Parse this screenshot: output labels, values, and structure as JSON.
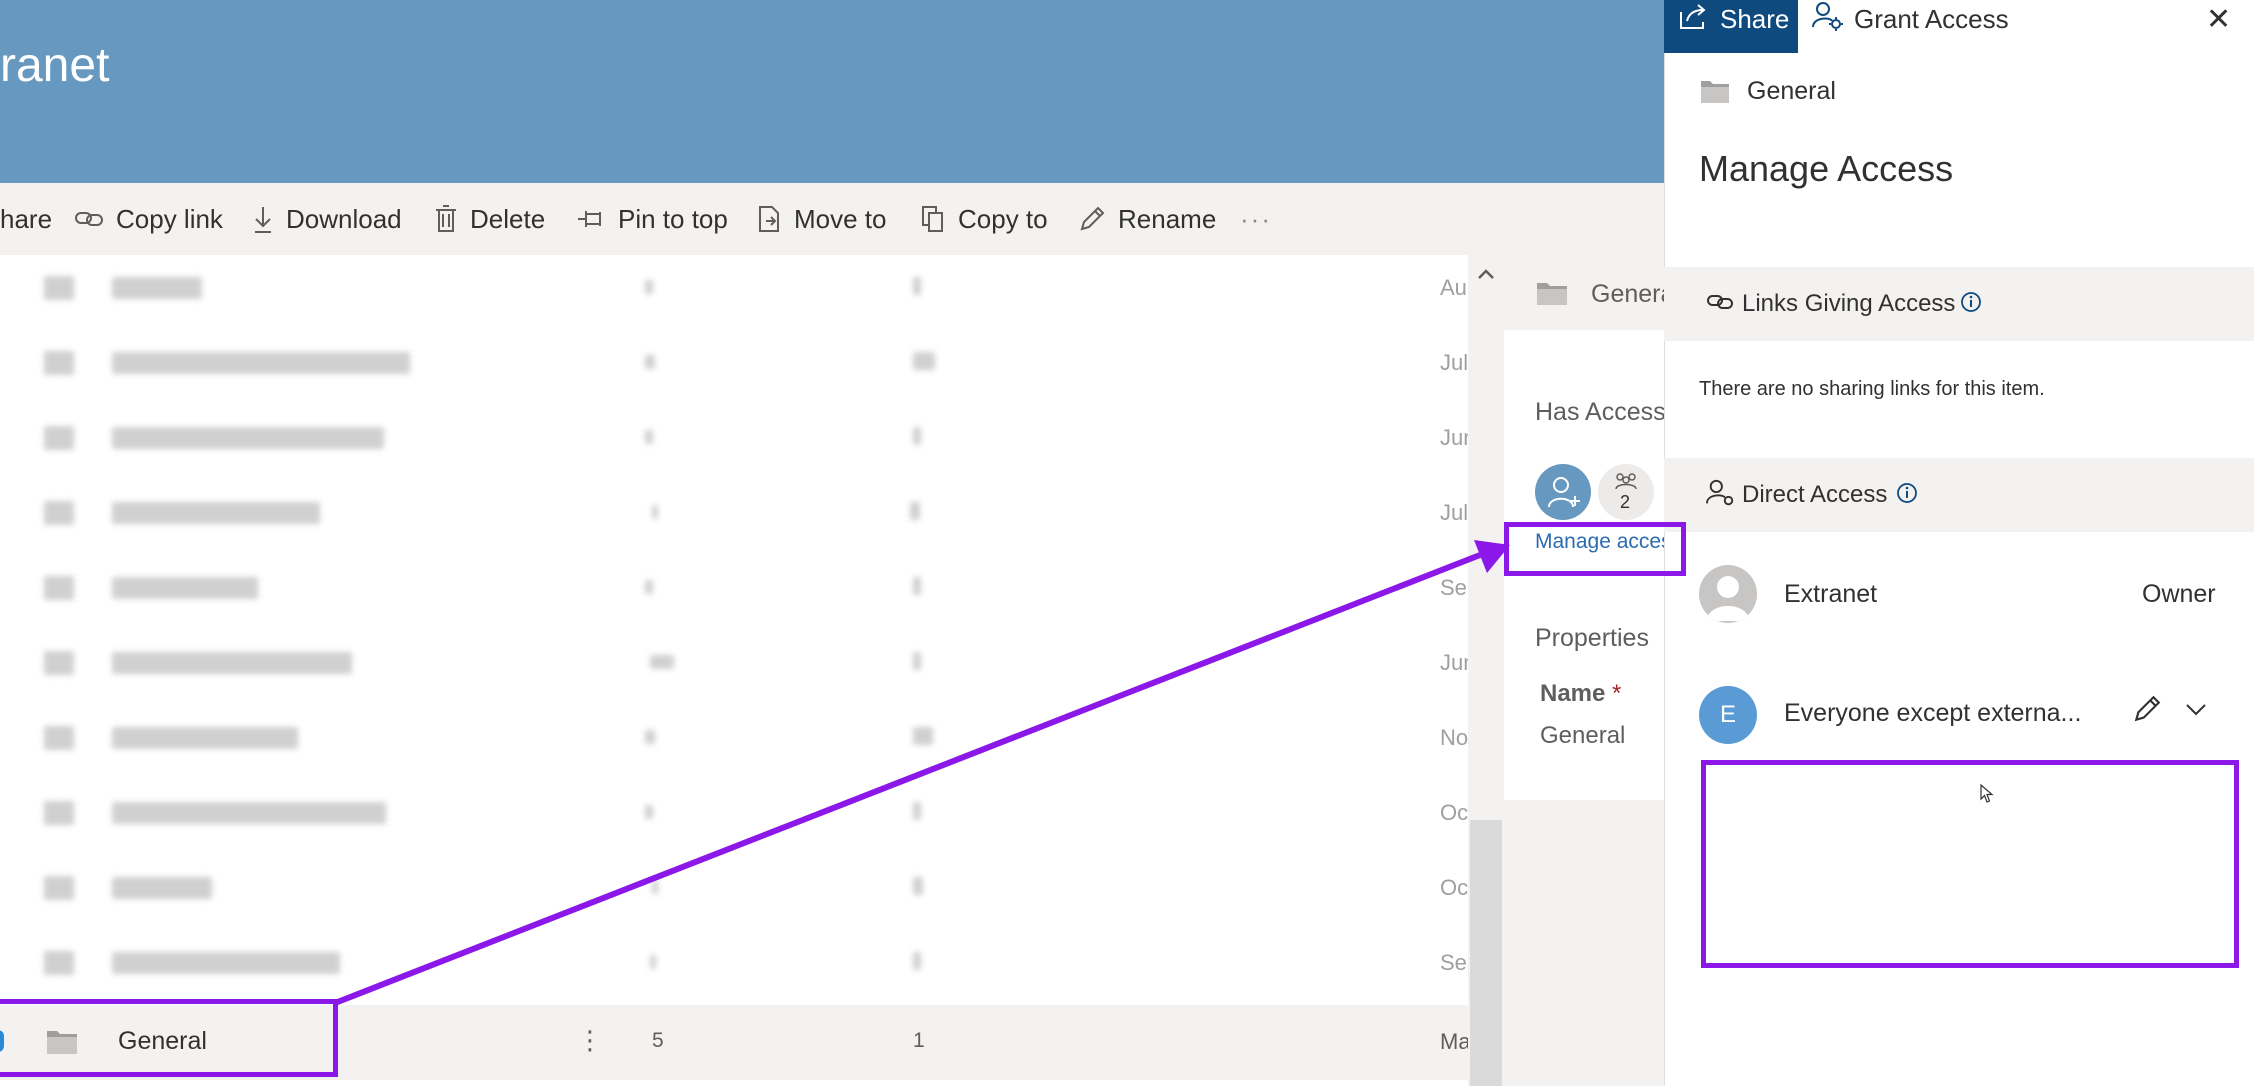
{
  "header": {
    "site_title": "ranet"
  },
  "command_bar": {
    "share": "hare",
    "copy_link": "Copy link",
    "download": "Download",
    "delete": "Delete",
    "pin_to_top": "Pin to top",
    "move_to": "Move to",
    "copy_to": "Copy to",
    "rename": "Rename",
    "more": "···"
  },
  "list": {
    "rows": [
      {
        "date": "Au"
      },
      {
        "date": "Jul"
      },
      {
        "date": "Jun"
      },
      {
        "date": "Jul"
      },
      {
        "date": "Se"
      },
      {
        "date": "Jun"
      },
      {
        "date": "No"
      },
      {
        "date": "Oc"
      },
      {
        "date": "Oc"
      },
      {
        "date": "Se"
      }
    ],
    "selected": {
      "name": "General",
      "items": "5",
      "size": "1",
      "date": "Ma",
      "more": "⋮"
    }
  },
  "details": {
    "folder_name": "Genera",
    "has_access": "Has Access",
    "member_count": "2",
    "manage_access": "Manage acces",
    "properties": "Properties",
    "name_label": "Name",
    "required_mark": "*",
    "name_value": "General"
  },
  "panel": {
    "tabs": {
      "share": "Share",
      "grant_access": "Grant Access"
    },
    "close": "✕",
    "folder_name": "General",
    "title": "Manage Access",
    "links_section": "Links Giving Access",
    "no_links": "There are no sharing links for this item.",
    "direct_section": "Direct Access",
    "entries": [
      {
        "initial": "",
        "name": "Extranet",
        "role": "Owner"
      },
      {
        "initial": "E",
        "name": "Everyone except externa...",
        "role": ""
      }
    ]
  },
  "colors": {
    "accent": "#8b17e8",
    "header": "#6698c0",
    "share_tab": "#0f4a7e",
    "link": "#2b6cb0"
  }
}
